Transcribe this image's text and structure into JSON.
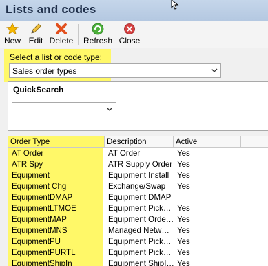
{
  "window": {
    "title": "Lists and codes"
  },
  "toolbar": {
    "buttons": [
      {
        "label": "New",
        "icon": "star-icon"
      },
      {
        "label": "Edit",
        "icon": "pencil-icon"
      },
      {
        "label": "Delete",
        "icon": "x-delete-icon"
      },
      {
        "label": "Refresh",
        "icon": "refresh-icon"
      },
      {
        "label": "Close",
        "icon": "close-circle-icon"
      }
    ]
  },
  "selector": {
    "label": "Select a list or code type:",
    "value": "Sales order types"
  },
  "quicksearch": {
    "title": "QuickSearch",
    "value": ""
  },
  "grid": {
    "columns": [
      "Order Type",
      "Description",
      "Active",
      ""
    ],
    "rows": [
      [
        "AT Order",
        "AT Order",
        "Yes"
      ],
      [
        "ATR Spy",
        "ATR Supply Order",
        "Yes"
      ],
      [
        "Equipment",
        "Equipment Install",
        "Yes"
      ],
      [
        "Equipment Chg",
        "Exchange/Swap",
        "Yes"
      ],
      [
        "EquipmentDMAP",
        "Equipment DMAP",
        ""
      ],
      [
        "EquipmentLTMOE",
        "Equipment Pick…",
        "Yes"
      ],
      [
        "EquipmentMAP",
        "Equipment Orde…",
        "Yes"
      ],
      [
        "EquipmentMNS",
        "Managed Netw…",
        "Yes"
      ],
      [
        "EquipmentPU",
        "Equipment Pick…",
        "Yes"
      ],
      [
        "EquipmentPURTL",
        "Equipment Pick…",
        "Yes"
      ],
      [
        "EquipmentShipIn",
        "Equipment ShipI…",
        "Yes"
      ]
    ]
  },
  "colors": {
    "highlight": "#fff868",
    "title_bar": "#c5d6ea"
  }
}
